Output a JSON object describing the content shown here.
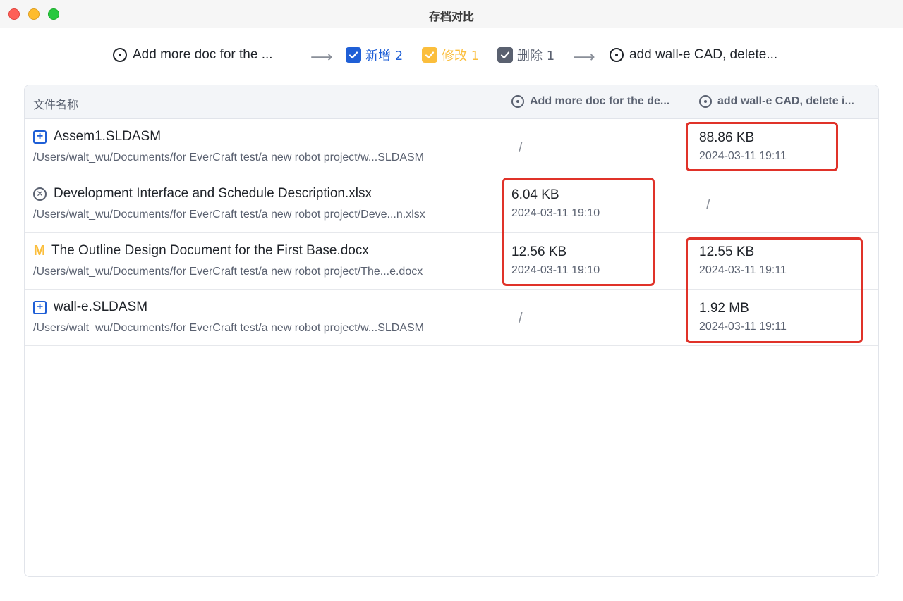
{
  "window": {
    "title": "存档对比"
  },
  "toolbar": {
    "from_version": "Add more doc for the ...",
    "arrow": "⟶",
    "added_label": "新增 2",
    "modified_label": "修改 1",
    "deleted_label": "删除 1",
    "to_version": "add wall-e CAD, delete..."
  },
  "table": {
    "headers": {
      "name": "文件名称",
      "col1": "Add more doc for the de...",
      "col2": "add wall-e CAD, delete i..."
    },
    "rows": [
      {
        "status": "added",
        "name": "Assem1.SLDASM",
        "path": "/Users/walt_wu/Documents/for EverCraft test/a new robot project/w...SLDASM",
        "col1": "/",
        "col2_size": "88.86 KB",
        "col2_date": "2024-03-11 19:11"
      },
      {
        "status": "deleted",
        "name": "Development Interface and Schedule Description.xlsx",
        "path": "/Users/walt_wu/Documents/for EverCraft test/a new robot project/Deve...n.xlsx",
        "col1_size": "6.04 KB",
        "col1_date": "2024-03-11 19:10",
        "col2": "/"
      },
      {
        "status": "modified",
        "status_glyph": "M",
        "name": "The Outline Design Document for the First Base.docx",
        "path": "/Users/walt_wu/Documents/for EverCraft test/a new robot project/The...e.docx",
        "col1_size": "12.56 KB",
        "col1_date": "2024-03-11 19:10",
        "col2_size": "12.55 KB",
        "col2_date": "2024-03-11 19:11"
      },
      {
        "status": "added",
        "name": "wall-e.SLDASM",
        "path": "/Users/walt_wu/Documents/for EverCraft test/a new robot project/w...SLDASM",
        "col1": "/",
        "col2_size": "1.92 MB",
        "col2_date": "2024-03-11 19:11"
      }
    ]
  },
  "colors": {
    "added": "#1f5fd6",
    "modified": "#fbbe3c",
    "deleted": "#5a6170",
    "highlight": "#e03229"
  },
  "icons": {
    "version": "circle-dot-icon",
    "added": "plus-square-icon",
    "deleted": "x-circle-icon",
    "modified": "m-letter-icon",
    "checkbox": "checkmark-icon"
  }
}
